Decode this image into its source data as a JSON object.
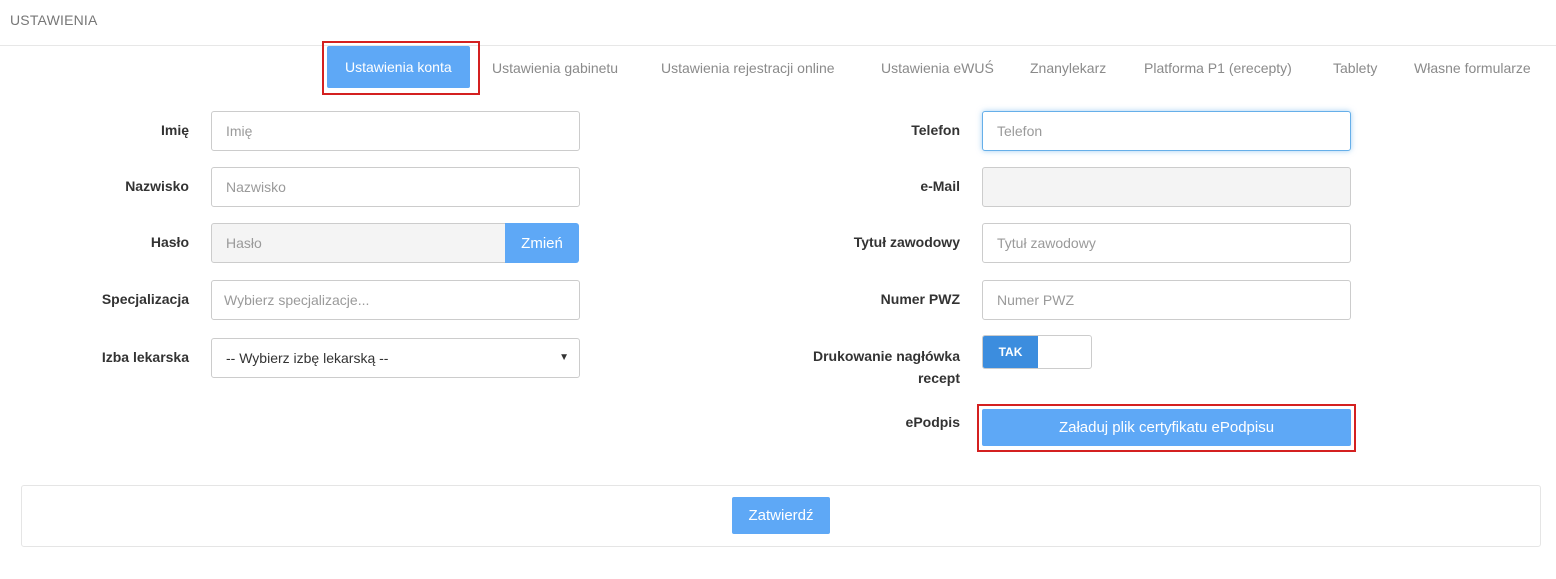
{
  "header": {
    "title": "USTAWIENIA"
  },
  "tabs": [
    {
      "label": "Ustawienia konta",
      "active": true
    },
    {
      "label": "Ustawienia gabinetu"
    },
    {
      "label": "Ustawienia rejestracji online"
    },
    {
      "label": "Ustawienia eWUŚ"
    },
    {
      "label": "Znanylekarz"
    },
    {
      "label": "Platforma P1 (erecepty)"
    },
    {
      "label": "Tablety"
    },
    {
      "label": "Własne formularze"
    }
  ],
  "left_form": {
    "imie": {
      "label": "Imię",
      "placeholder": "Imię",
      "value": ""
    },
    "nazwisko": {
      "label": "Nazwisko",
      "placeholder": "Nazwisko",
      "value": ""
    },
    "haslo": {
      "label": "Hasło",
      "placeholder": "Hasło",
      "change_button": "Zmień"
    },
    "specjalizacja": {
      "label": "Specjalizacja",
      "placeholder": "Wybierz specjalizacje..."
    },
    "izba": {
      "label": "Izba lekarska",
      "selected": "-- Wybierz izbę lekarską --",
      "caret": "▼"
    }
  },
  "right_form": {
    "telefon": {
      "label": "Telefon",
      "placeholder": "Telefon",
      "value": ""
    },
    "email": {
      "label": "e-Mail",
      "value": ""
    },
    "tytul": {
      "label": "Tytuł zawodowy",
      "placeholder": "Tytuł zawodowy"
    },
    "pwz": {
      "label": "Numer PWZ",
      "placeholder": "Numer PWZ"
    },
    "naglowek": {
      "label_line1": "Drukowanie nagłówka",
      "label_line2": "recept",
      "toggle_on": "TAK"
    },
    "epodpis": {
      "label": "ePodpis",
      "button": "Załaduj plik certyfikatu ePodpisu"
    }
  },
  "footer": {
    "submit": "Zatwierdź"
  },
  "colors": {
    "accent": "#5ea8f6",
    "toggle": "#3c8dde",
    "highlight": "#d42020"
  }
}
